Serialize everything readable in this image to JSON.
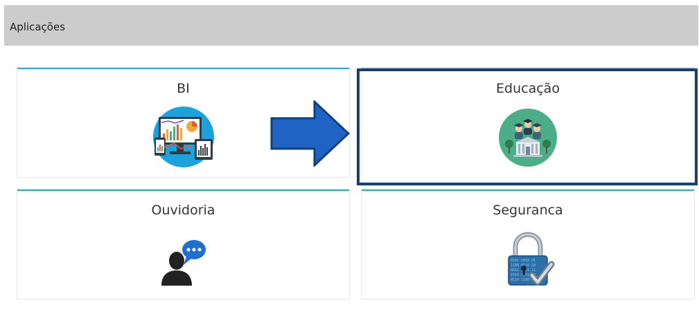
{
  "header": {
    "title": "Aplicações"
  },
  "cards": [
    {
      "label": "BI",
      "icon": "bi-dashboard-icon"
    },
    {
      "label": "Educação",
      "icon": "school-graduates-icon"
    },
    {
      "label": "Ouvidoria",
      "icon": "person-speech-bubble-icon"
    },
    {
      "label": "Seguranca",
      "icon": "padlock-check-icon"
    }
  ],
  "annotation": {
    "arrow_icon": "blue-arrow-right-icon",
    "highlight_color": "#173e6e"
  },
  "colors": {
    "header_bg": "#cccccc",
    "accent_blue": "#3aa0d8",
    "accent_teal": "#1fb5b8"
  }
}
